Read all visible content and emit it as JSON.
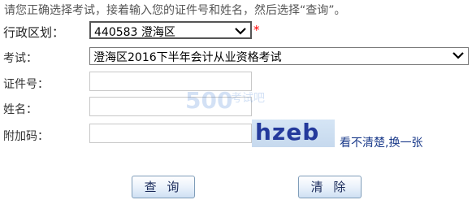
{
  "instruction": "请您正确选择考试，接着输入您的证件号和姓名，然后选择“查询”。",
  "form": {
    "region": {
      "label": "行政区划：",
      "value": "440583 澄海区",
      "required_mark": "*"
    },
    "exam": {
      "label": "考试：",
      "value": "澄海区2016下半年会计从业资格考试"
    },
    "id_number": {
      "label": "证件号：",
      "value": ""
    },
    "name": {
      "label": "姓名：",
      "value": ""
    },
    "captcha": {
      "label": "附加码：",
      "value": "",
      "image_text": "hzeb",
      "refresh_link": "看不清楚,换一张"
    }
  },
  "buttons": {
    "query": "查 询",
    "clear": "清 除"
  },
  "watermark": {
    "text": "考试吧",
    "number": "500"
  },
  "colors": {
    "required": "#ff0000",
    "link": "#1a3a8a",
    "captcha_text": "#243a9c",
    "captcha_bg": "#c6d9ee",
    "button_border": "#7f9db9"
  }
}
